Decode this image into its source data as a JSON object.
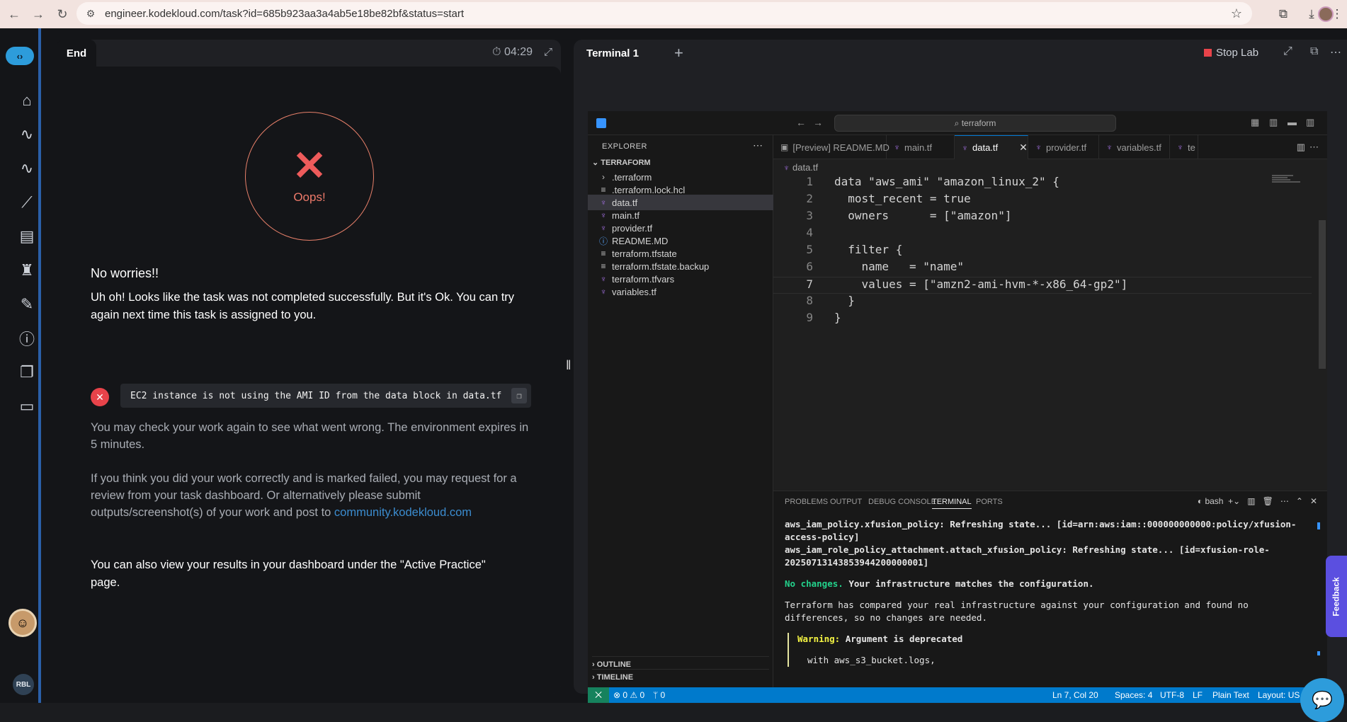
{
  "browser": {
    "url": "engineer.kodekloud.com/task?id=685b923aa3a4ab5e18be82bf&status=start"
  },
  "task_panel": {
    "tab_label": "End",
    "timer": "04:29",
    "oops_label": "Oops!",
    "heading": "No worries!!",
    "message": "Uh oh! Looks like the task was not completed successfully. But it's Ok. You can try again next time this task is assigned to you.",
    "error_text": "EC2 instance is not using the AMI ID from the data block in data.tf",
    "recheck_text": "You may check your work again to see what went wrong. The environment expires in 5 minutes.",
    "review_text": "If you think you did your work correctly and is marked failed, you may request for a review from your task dashboard. Or alternatively please submit outputs/screenshot(s) of your work and post to ",
    "community_link": "community.kodekloud.com",
    "dashboard_text": "You can also view your results in your dashboard under the \"Active Practice\" page."
  },
  "sidebar": {
    "user_initials": "RBL"
  },
  "terminal_panel": {
    "tab_label": "Terminal 1",
    "stop_lab": "Stop Lab"
  },
  "vscode": {
    "search": "terraform",
    "explorer_title": "EXPLORER",
    "root_folder": "TERRAFORM",
    "files": [
      {
        "name": ".terraform",
        "icon": "chevron-right"
      },
      {
        "name": ".terraform.lock.hcl",
        "icon": "doc"
      },
      {
        "name": "data.tf",
        "icon": "tf"
      },
      {
        "name": "main.tf",
        "icon": "tf"
      },
      {
        "name": "provider.tf",
        "icon": "tf"
      },
      {
        "name": "README.MD",
        "icon": "info"
      },
      {
        "name": "terraform.tfstate",
        "icon": "doc"
      },
      {
        "name": "terraform.tfstate.backup",
        "icon": "doc"
      },
      {
        "name": "terraform.tfvars",
        "icon": "tf"
      },
      {
        "name": "variables.tf",
        "icon": "tf"
      }
    ],
    "outline_label": "OUTLINE",
    "timeline_label": "TIMELINE",
    "tabs": [
      "[Preview] README.MD",
      "main.tf",
      "data.tf",
      "provider.tf",
      "variables.tf",
      "te"
    ],
    "breadcrumb": "data.tf",
    "code_lines": [
      {
        "n": "1",
        "t": "data \"aws_ami\" \"amazon_linux_2\" {"
      },
      {
        "n": "2",
        "t": "  most_recent = true"
      },
      {
        "n": "3",
        "t": "  owners      = [\"amazon\"]"
      },
      {
        "n": "4",
        "t": ""
      },
      {
        "n": "5",
        "t": "  filter {"
      },
      {
        "n": "6",
        "t": "    name   = \"name\""
      },
      {
        "n": "7",
        "t": "    values = [\"amzn2-ami-hvm-*-x86_64-gp2\"]"
      },
      {
        "n": "8",
        "t": "  }"
      },
      {
        "n": "9",
        "t": "}"
      }
    ],
    "panel_tabs": [
      "PROBLEMS",
      "OUTPUT",
      "DEBUG CONSOLE",
      "TERMINAL",
      "PORTS"
    ],
    "shell_name": "bash",
    "terminal": {
      "line1": "aws_iam_policy.xfusion_policy: Refreshing state... [id=arn:aws:iam::000000000000:policy/xfusion-access-policy]",
      "line2": "aws_iam_role_policy_attachment.attach_xfusion_policy: Refreshing state... [id=xfusion-role-20250713143853944200000001]",
      "no_changes": "No changes.",
      "no_changes_rest": " Your infrastructure matches the configuration.",
      "compared": "Terraform has compared your real infrastructure against your configuration and found no differences, so no changes are needed.",
      "warning_label": "Warning:",
      "warning_rest": " Argument is deprecated",
      "with_line": "with aws_s3_bucket.logs,"
    },
    "status": {
      "errors": "0",
      "warnings": "0",
      "ports": "0",
      "position": "Ln 7, Col 20",
      "spaces": "Spaces: 4",
      "encoding": "UTF-8",
      "eol": "LF",
      "language": "Plain Text",
      "layout": "Layout: US"
    }
  },
  "feedback_label": "Feedback"
}
